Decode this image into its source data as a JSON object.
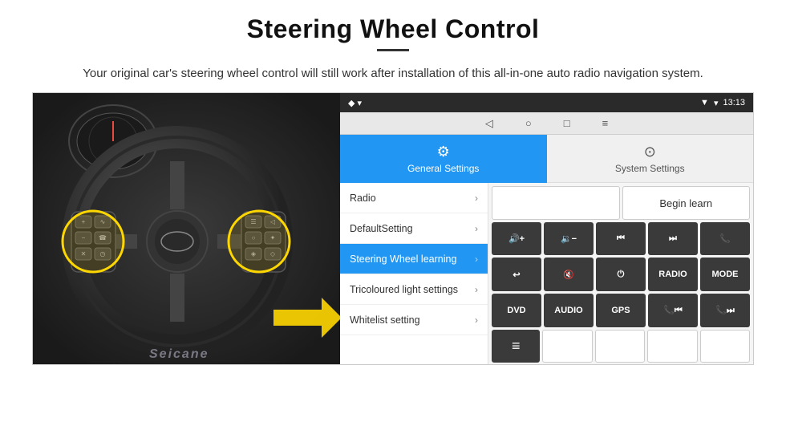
{
  "page": {
    "title": "Steering Wheel Control",
    "subtitle": "Your original car's steering wheel control will still work after installation of this all-in-one auto radio navigation system."
  },
  "statusBar": {
    "time": "13:13",
    "wifiIcon": "▼",
    "gpsIcon": "◆",
    "signalIcon": "▾"
  },
  "navBar": {
    "backIcon": "◁",
    "homeIcon": "○",
    "recentIcon": "□",
    "menuIcon": "≡"
  },
  "tabs": [
    {
      "id": "general",
      "label": "General Settings",
      "icon": "⚙",
      "active": true
    },
    {
      "id": "system",
      "label": "System Settings",
      "icon": "⊙",
      "active": false
    }
  ],
  "menuItems": [
    {
      "id": "radio",
      "label": "Radio",
      "active": false
    },
    {
      "id": "defaultSetting",
      "label": "DefaultSetting",
      "active": false
    },
    {
      "id": "steeringWheel",
      "label": "Steering Wheel learning",
      "active": true
    },
    {
      "id": "tricolouredLight",
      "label": "Tricoloured light settings",
      "active": false
    },
    {
      "id": "whitelistSetting",
      "label": "Whitelist setting",
      "active": false
    }
  ],
  "controls": {
    "row1": {
      "emptyLabel": "",
      "beginLearnLabel": "Begin learn"
    },
    "row2": {
      "volUp": "🔊+",
      "volDown": "🔉−",
      "prevTrack": "⏮",
      "nextTrack": "⏭",
      "phone": "📞"
    },
    "row3": {
      "hangUp": "↩",
      "mute": "🔇",
      "power": "⏻",
      "radio": "RADIO",
      "mode": "MODE"
    },
    "row4": {
      "dvd": "DVD",
      "audio": "AUDIO",
      "gps": "GPS",
      "phonePrev": "📞⏮",
      "phoneFwd": "📞⏭"
    },
    "row5": {
      "list": "≡"
    }
  },
  "watermark": "Seicane"
}
